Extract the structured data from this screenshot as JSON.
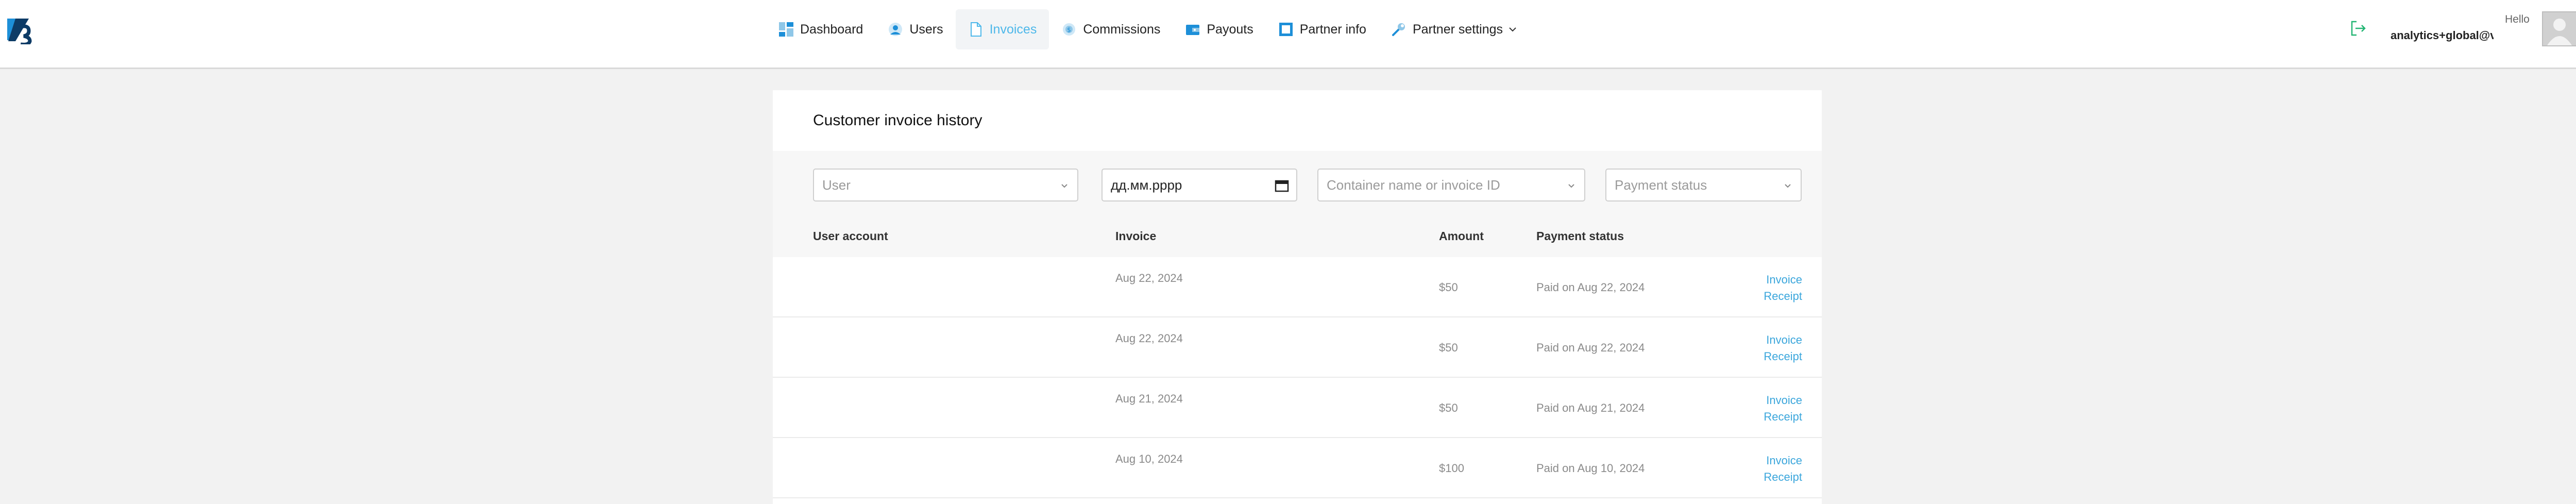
{
  "header": {
    "logo_icon": "zs-logo-icon",
    "nav": [
      {
        "label": "Dashboard",
        "icon": "dashboard-icon"
      },
      {
        "label": "Users",
        "icon": "users-icon"
      },
      {
        "label": "Invoices",
        "icon": "invoice-icon",
        "active": true
      },
      {
        "label": "Commissions",
        "icon": "commissions-icon"
      },
      {
        "label": "Payouts",
        "icon": "payouts-icon"
      },
      {
        "label": "Partner info",
        "icon": "partner-info-icon"
      },
      {
        "label": "Partner settings",
        "icon": "wrench-icon"
      }
    ],
    "greeting": "Hello",
    "user_email": "analytics+global@v",
    "accent_color": "#4db8ea"
  },
  "page": {
    "title": "Customer invoice history",
    "filters": {
      "user_placeholder": "User",
      "date_value": "дд.мм.рррр",
      "container_placeholder": "Container name or invoice ID",
      "payment_placeholder": "Payment status"
    },
    "columns": {
      "user_account": "User account",
      "invoice": "Invoice",
      "amount": "Amount",
      "payment_status": "Payment status"
    },
    "rows": [
      {
        "date": "Aug 22, 2024",
        "amount": "$50",
        "status": "Paid on Aug 22, 2024",
        "invoice_link": "Invoice",
        "receipt_link": "Receipt"
      },
      {
        "date": "Aug 22, 2024",
        "amount": "$50",
        "status": "Paid on Aug 22, 2024",
        "invoice_link": "Invoice",
        "receipt_link": "Receipt"
      },
      {
        "date": "Aug 21, 2024",
        "amount": "$50",
        "status": "Paid on Aug 21, 2024",
        "invoice_link": "Invoice",
        "receipt_link": "Receipt"
      },
      {
        "date": "Aug 10, 2024",
        "amount": "$100",
        "status": "Paid on Aug 10, 2024",
        "invoice_link": "Invoice",
        "receipt_link": "Receipt"
      }
    ]
  }
}
